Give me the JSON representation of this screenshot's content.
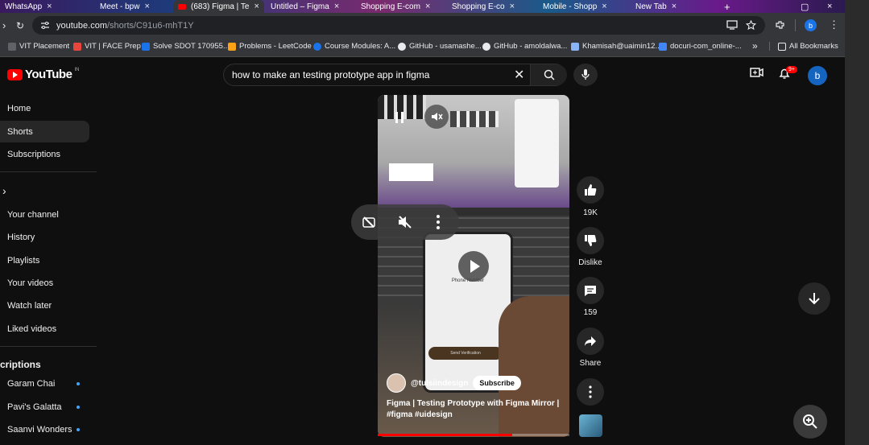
{
  "browser": {
    "tabs": [
      {
        "label": "WhatsApp"
      },
      {
        "label": "Meet - bpw"
      },
      {
        "label": "(683) Figma | Te"
      },
      {
        "label": "Untitled – Figma"
      },
      {
        "label": "Shopping E-com"
      },
      {
        "label": "Shopping E-co"
      },
      {
        "label": "Mobile - Shopp"
      },
      {
        "label": "New Tab"
      }
    ],
    "url_host": "youtube.com",
    "url_path": "/shorts/C91u6-mhT1Y",
    "profile_initial": "b",
    "bookmarks": [
      {
        "label": "VIT Placement",
        "color": "#5f6368"
      },
      {
        "label": "VIT | FACE Prep",
        "color": "#e8453c"
      },
      {
        "label": "Solve SDOT 170955...",
        "color": "#1a73e8"
      },
      {
        "label": "Problems - LeetCode",
        "color": "#ffa116"
      },
      {
        "label": "Course Modules: A...",
        "color": "#1a73e8"
      },
      {
        "label": "GitHub - usamashe...",
        "color": "#e8eaed"
      },
      {
        "label": "GitHub - amoldalwa...",
        "color": "#e8eaed"
      },
      {
        "label": "Khamisah@uaimin12...",
        "color": "#8ab4f8"
      },
      {
        "label": "docuri-com_online-...",
        "color": "#4285f4"
      }
    ],
    "all_bookmarks": "All Bookmarks",
    "more_chevron": "»"
  },
  "youtube": {
    "logo_text": "YouTube",
    "logo_country": "IN",
    "search_value": "how to make an testing prototype app in figma",
    "notifications_badge": "9+",
    "avatar_initial": "b",
    "sidebar": {
      "items": [
        {
          "label": "Home"
        },
        {
          "label": "Shorts"
        },
        {
          "label": "Subscriptions"
        }
      ],
      "you_chevron": "›",
      "you_items": [
        {
          "label": "Your channel"
        },
        {
          "label": "History"
        },
        {
          "label": "Playlists"
        },
        {
          "label": "Your videos"
        },
        {
          "label": "Watch later"
        },
        {
          "label": "Liked videos"
        }
      ],
      "subs_heading": "criptions",
      "subscriptions": [
        {
          "label": "Garam Chai"
        },
        {
          "label": "Pavi's Galatta"
        },
        {
          "label": "Saanvi Wonders"
        }
      ]
    },
    "short": {
      "channel": "@tulsiindesign",
      "subscribe_label": "Subscribe",
      "title": "Figma | Testing Prototype with Figma Mirror | #figma #uidesign",
      "progress": 0.7,
      "phone_heading": "Phone Number",
      "phone_button": "Send Verification"
    },
    "actions": {
      "likes": "19K",
      "dislike_label": "Dislike",
      "comments": "159",
      "share_label": "Share"
    }
  }
}
